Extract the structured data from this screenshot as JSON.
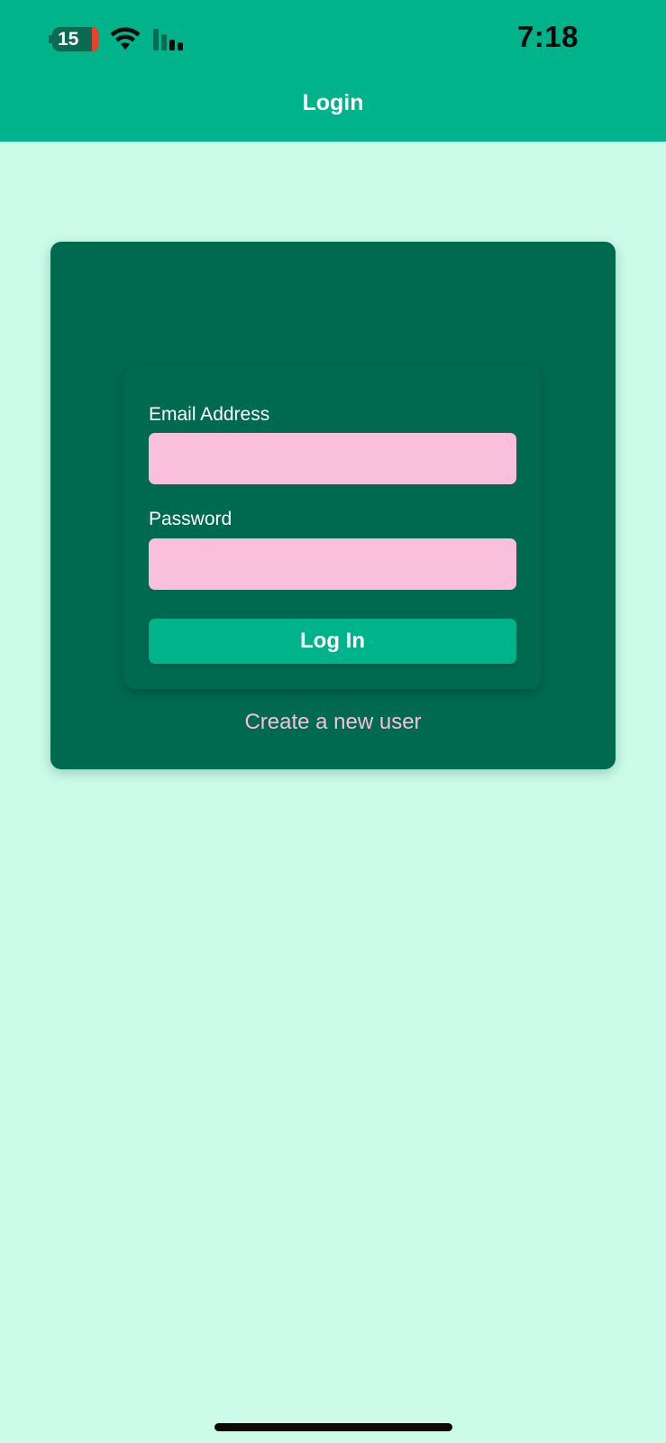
{
  "status_bar": {
    "time": "7:18",
    "battery_level": "15",
    "icons": [
      "battery-charging-icon",
      "wifi-icon",
      "cellular-signal-icon"
    ]
  },
  "nav": {
    "title": "Login"
  },
  "login_form": {
    "email_label": "Email Address",
    "email_value": "",
    "password_label": "Password",
    "password_value": "",
    "submit_label": "Log In",
    "create_user_link": "Create a new user"
  },
  "colors": {
    "header": "#00b38a",
    "background": "#ccfce9",
    "card": "#006a51",
    "input": "#f9bfdb",
    "button": "#00b38a",
    "link": "#f9bfdb",
    "battery_low": "#e8412e"
  }
}
